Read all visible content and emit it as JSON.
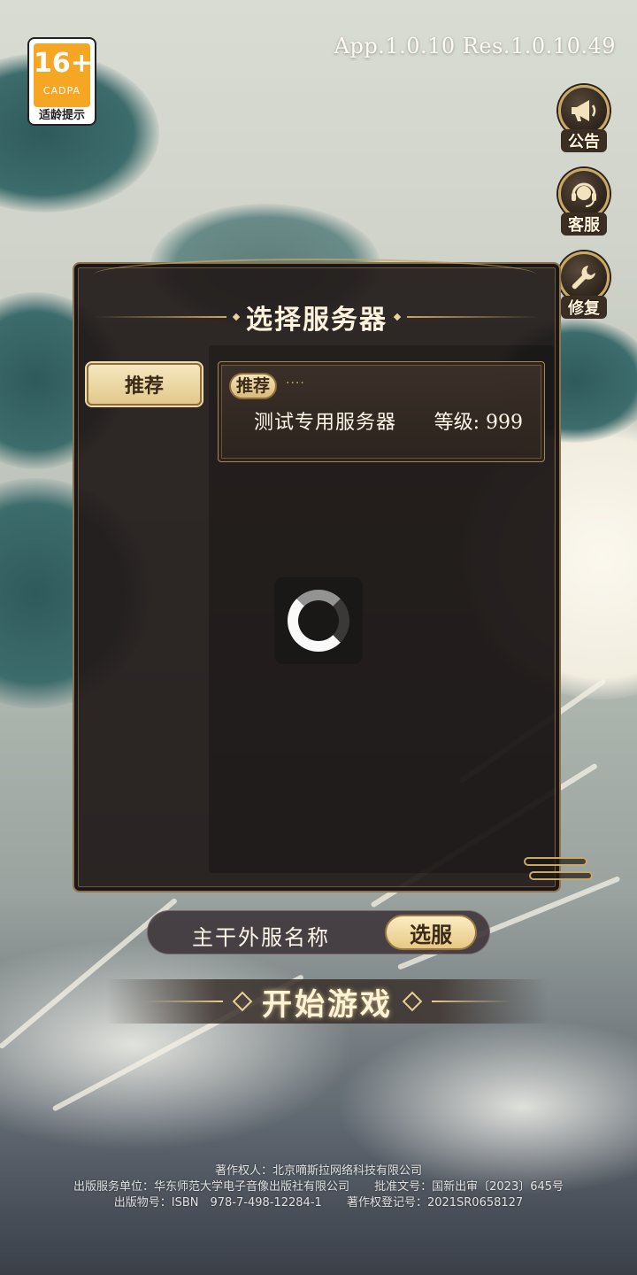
{
  "age_badge": {
    "rating": "16+",
    "org": "CADPA",
    "tip": "适龄提示"
  },
  "version": "App.1.0.10 Res.1.0.10.49",
  "side_buttons": {
    "announcement": {
      "label": "公告",
      "icon": "megaphone-icon"
    },
    "service": {
      "label": "客服",
      "icon": "headset-icon"
    },
    "repair": {
      "label": "修复",
      "icon": "wrench-icon"
    }
  },
  "server_dialog": {
    "title": "选择服务器",
    "tabs": [
      {
        "label": "推荐",
        "selected": true
      }
    ],
    "servers": [
      {
        "tag": "推荐",
        "name": "测试专用服务器",
        "level": "等级: 999"
      }
    ],
    "loading": true
  },
  "current_server": {
    "name": "主干外服名称",
    "select_label": "选服"
  },
  "start_button": {
    "label": "开始游戏"
  },
  "footer": {
    "line1": "著作权人：北京嘀斯拉网络科技有限公司",
    "line2_a": "出版服务单位：华东师范大学电子音像出版社有限公司",
    "line2_b": "批准文号：国新出审〔2023〕645号",
    "line3_a": "出版物号：ISBN　978-7-498-12284-1",
    "line3_b": "著作权登记号：2021SR0658127"
  },
  "colors": {
    "gold": "#c9a865",
    "panel": "#211b1a",
    "badge_orange": "#f5a623"
  }
}
